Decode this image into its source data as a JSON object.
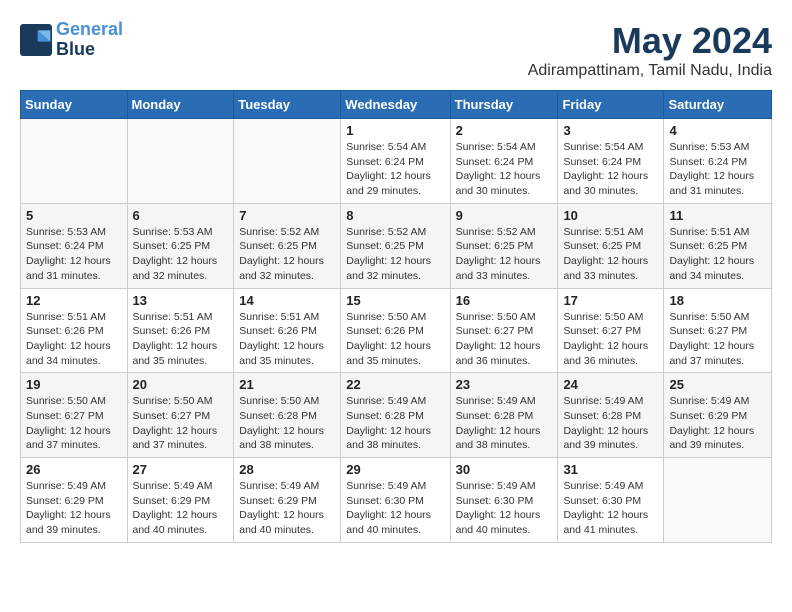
{
  "header": {
    "logo_line1": "General",
    "logo_line2": "Blue",
    "month": "May 2024",
    "location": "Adirampattinam, Tamil Nadu, India"
  },
  "weekdays": [
    "Sunday",
    "Monday",
    "Tuesday",
    "Wednesday",
    "Thursday",
    "Friday",
    "Saturday"
  ],
  "weeks": [
    [
      {
        "day": "",
        "info": ""
      },
      {
        "day": "",
        "info": ""
      },
      {
        "day": "",
        "info": ""
      },
      {
        "day": "1",
        "info": "Sunrise: 5:54 AM\nSunset: 6:24 PM\nDaylight: 12 hours\nand 29 minutes."
      },
      {
        "day": "2",
        "info": "Sunrise: 5:54 AM\nSunset: 6:24 PM\nDaylight: 12 hours\nand 30 minutes."
      },
      {
        "day": "3",
        "info": "Sunrise: 5:54 AM\nSunset: 6:24 PM\nDaylight: 12 hours\nand 30 minutes."
      },
      {
        "day": "4",
        "info": "Sunrise: 5:53 AM\nSunset: 6:24 PM\nDaylight: 12 hours\nand 31 minutes."
      }
    ],
    [
      {
        "day": "5",
        "info": "Sunrise: 5:53 AM\nSunset: 6:24 PM\nDaylight: 12 hours\nand 31 minutes."
      },
      {
        "day": "6",
        "info": "Sunrise: 5:53 AM\nSunset: 6:25 PM\nDaylight: 12 hours\nand 32 minutes."
      },
      {
        "day": "7",
        "info": "Sunrise: 5:52 AM\nSunset: 6:25 PM\nDaylight: 12 hours\nand 32 minutes."
      },
      {
        "day": "8",
        "info": "Sunrise: 5:52 AM\nSunset: 6:25 PM\nDaylight: 12 hours\nand 32 minutes."
      },
      {
        "day": "9",
        "info": "Sunrise: 5:52 AM\nSunset: 6:25 PM\nDaylight: 12 hours\nand 33 minutes."
      },
      {
        "day": "10",
        "info": "Sunrise: 5:51 AM\nSunset: 6:25 PM\nDaylight: 12 hours\nand 33 minutes."
      },
      {
        "day": "11",
        "info": "Sunrise: 5:51 AM\nSunset: 6:25 PM\nDaylight: 12 hours\nand 34 minutes."
      }
    ],
    [
      {
        "day": "12",
        "info": "Sunrise: 5:51 AM\nSunset: 6:26 PM\nDaylight: 12 hours\nand 34 minutes."
      },
      {
        "day": "13",
        "info": "Sunrise: 5:51 AM\nSunset: 6:26 PM\nDaylight: 12 hours\nand 35 minutes."
      },
      {
        "day": "14",
        "info": "Sunrise: 5:51 AM\nSunset: 6:26 PM\nDaylight: 12 hours\nand 35 minutes."
      },
      {
        "day": "15",
        "info": "Sunrise: 5:50 AM\nSunset: 6:26 PM\nDaylight: 12 hours\nand 35 minutes."
      },
      {
        "day": "16",
        "info": "Sunrise: 5:50 AM\nSunset: 6:27 PM\nDaylight: 12 hours\nand 36 minutes."
      },
      {
        "day": "17",
        "info": "Sunrise: 5:50 AM\nSunset: 6:27 PM\nDaylight: 12 hours\nand 36 minutes."
      },
      {
        "day": "18",
        "info": "Sunrise: 5:50 AM\nSunset: 6:27 PM\nDaylight: 12 hours\nand 37 minutes."
      }
    ],
    [
      {
        "day": "19",
        "info": "Sunrise: 5:50 AM\nSunset: 6:27 PM\nDaylight: 12 hours\nand 37 minutes."
      },
      {
        "day": "20",
        "info": "Sunrise: 5:50 AM\nSunset: 6:27 PM\nDaylight: 12 hours\nand 37 minutes."
      },
      {
        "day": "21",
        "info": "Sunrise: 5:50 AM\nSunset: 6:28 PM\nDaylight: 12 hours\nand 38 minutes."
      },
      {
        "day": "22",
        "info": "Sunrise: 5:49 AM\nSunset: 6:28 PM\nDaylight: 12 hours\nand 38 minutes."
      },
      {
        "day": "23",
        "info": "Sunrise: 5:49 AM\nSunset: 6:28 PM\nDaylight: 12 hours\nand 38 minutes."
      },
      {
        "day": "24",
        "info": "Sunrise: 5:49 AM\nSunset: 6:28 PM\nDaylight: 12 hours\nand 39 minutes."
      },
      {
        "day": "25",
        "info": "Sunrise: 5:49 AM\nSunset: 6:29 PM\nDaylight: 12 hours\nand 39 minutes."
      }
    ],
    [
      {
        "day": "26",
        "info": "Sunrise: 5:49 AM\nSunset: 6:29 PM\nDaylight: 12 hours\nand 39 minutes."
      },
      {
        "day": "27",
        "info": "Sunrise: 5:49 AM\nSunset: 6:29 PM\nDaylight: 12 hours\nand 40 minutes."
      },
      {
        "day": "28",
        "info": "Sunrise: 5:49 AM\nSunset: 6:29 PM\nDaylight: 12 hours\nand 40 minutes."
      },
      {
        "day": "29",
        "info": "Sunrise: 5:49 AM\nSunset: 6:30 PM\nDaylight: 12 hours\nand 40 minutes."
      },
      {
        "day": "30",
        "info": "Sunrise: 5:49 AM\nSunset: 6:30 PM\nDaylight: 12 hours\nand 40 minutes."
      },
      {
        "day": "31",
        "info": "Sunrise: 5:49 AM\nSunset: 6:30 PM\nDaylight: 12 hours\nand 41 minutes."
      },
      {
        "day": "",
        "info": ""
      }
    ]
  ]
}
